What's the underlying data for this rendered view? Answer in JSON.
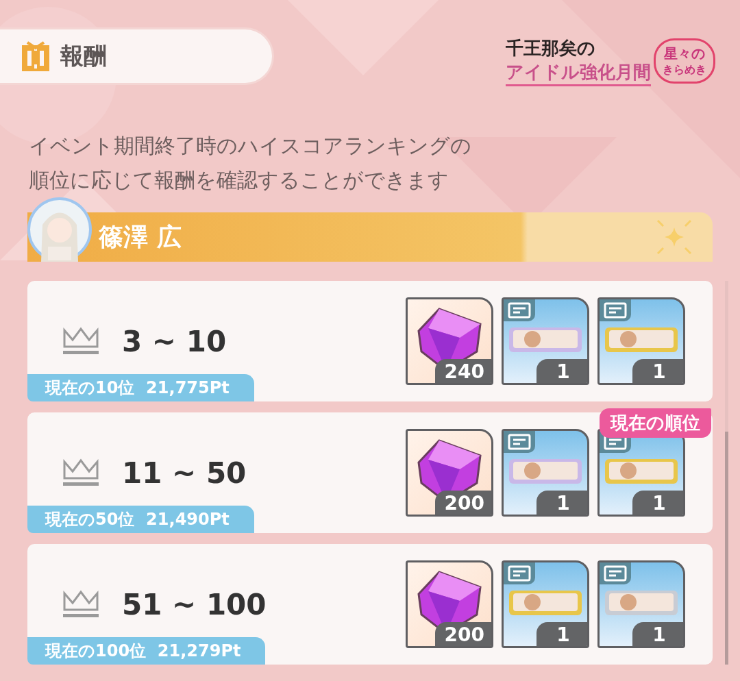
{
  "header": {
    "title": "報酬"
  },
  "logo": {
    "line_1": "千王那矣の",
    "line_2": "アイドル強化月間",
    "badge_1": "星々の",
    "badge_2": "きらめき"
  },
  "description": [
    "イベント期間終了時のハイスコアランキングの",
    "順位に応じて報酬を確認することができます"
  ],
  "idol": {
    "name": "篠澤 広"
  },
  "rows": [
    {
      "rank": "3 ~ 10",
      "current_score": "現在の10位  21,775Pt",
      "current": false,
      "items": [
        {
          "kind": "gem",
          "count": "240"
        },
        {
          "kind": "ticket",
          "color": "#c9b8e8",
          "count": "1"
        },
        {
          "kind": "ticket",
          "color": "#e8c64a",
          "count": "1"
        }
      ]
    },
    {
      "rank": "11 ~ 50",
      "current_score": "現在の50位  21,490Pt",
      "current": true,
      "current_label": "現在の順位",
      "items": [
        {
          "kind": "gem",
          "count": "200"
        },
        {
          "kind": "ticket",
          "color": "#c9b8e8",
          "count": "1"
        },
        {
          "kind": "ticket",
          "color": "#e8c64a",
          "count": "1"
        }
      ]
    },
    {
      "rank": "51 ~ 100",
      "current_score": "現在の100位  21,279Pt",
      "current": false,
      "items": [
        {
          "kind": "gem",
          "count": "200"
        },
        {
          "kind": "ticket",
          "color": "#e8c64a",
          "count": "1"
        },
        {
          "kind": "ticket",
          "color": "#c8ccd4",
          "count": "1"
        }
      ]
    }
  ]
}
